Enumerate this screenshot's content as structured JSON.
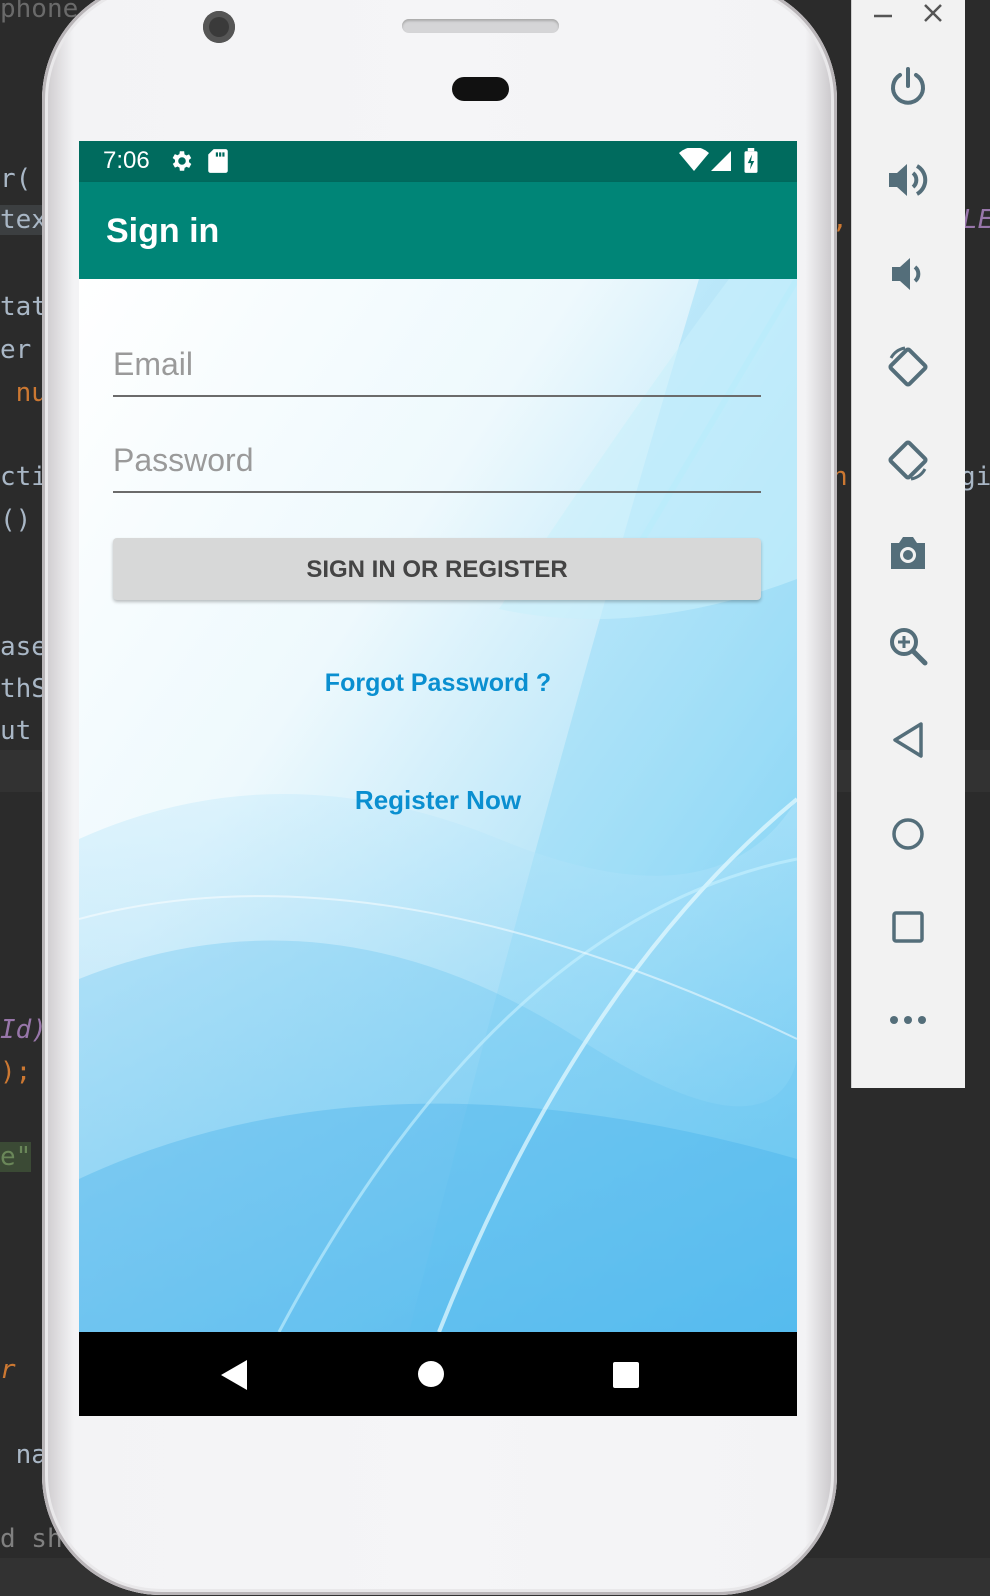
{
  "ide": {
    "fragments": [
      "phone",
      "r(",
      "tex",
      "tat",
      "er",
      " nu",
      "cti",
      "()",
      "ase",
      "thS",
      "ut",
      "Id)",
      ");",
      "e\"",
      "r",
      " na",
      "d sh",
      ",",
      "LE",
      "n",
      "gi"
    ]
  },
  "status_bar": {
    "time": "7:06",
    "icons": [
      "gear-icon",
      "sd-card-icon",
      "wifi-icon",
      "signal-icon",
      "battery-charging-icon"
    ]
  },
  "app_bar": {
    "title": "Sign in"
  },
  "form": {
    "email_placeholder": "Email",
    "email_value": "",
    "password_placeholder": "Password",
    "password_value": "",
    "submit_label": "SIGN IN OR REGISTER",
    "forgot_password_label": "Forgot Password ?",
    "register_label": "Register Now"
  },
  "colors": {
    "status_bar": "#006b5e",
    "app_bar": "#008577",
    "link": "#0a8fd0",
    "button": "#d7d8d8"
  },
  "emulator_panel": {
    "window_controls": [
      "minimize-icon",
      "close-icon"
    ],
    "buttons": [
      "power-icon",
      "volume-up-icon",
      "volume-down-icon",
      "rotate-left-icon",
      "rotate-right-icon",
      "camera-icon",
      "zoom-icon",
      "back-icon",
      "home-icon",
      "overview-icon",
      "more-icon"
    ]
  }
}
